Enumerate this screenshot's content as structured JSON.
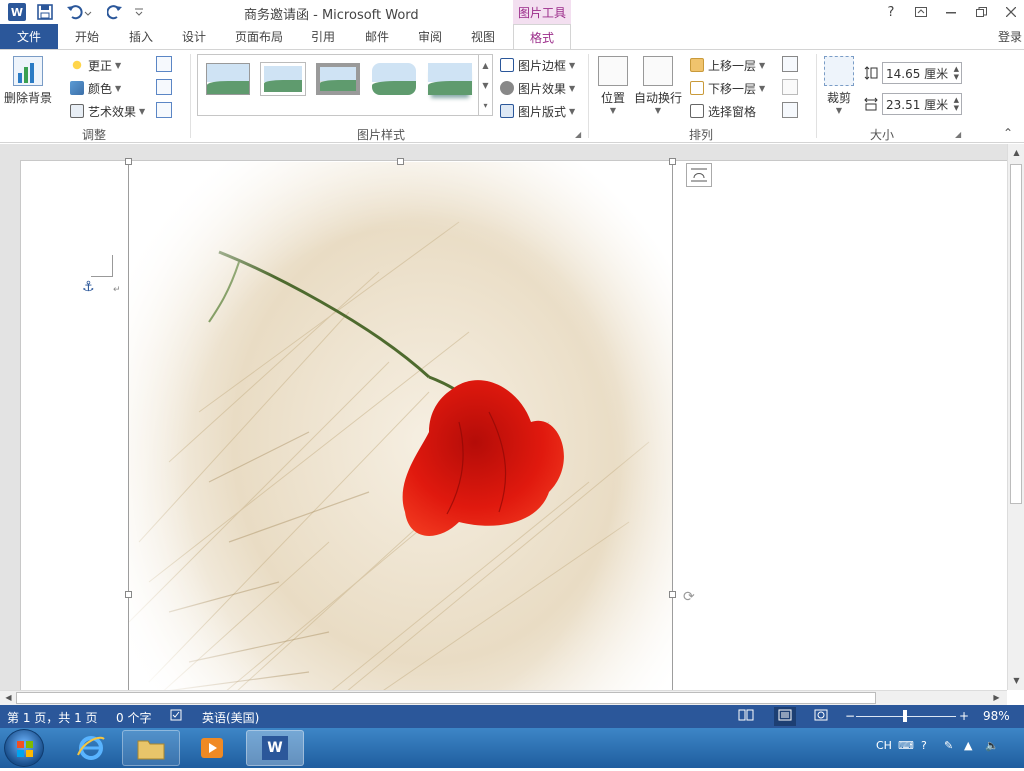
{
  "window": {
    "title": "商务邀请函 - Microsoft Word",
    "context_tab_group": "图片工具",
    "help": "?",
    "sign_in": "登录"
  },
  "tabs": [
    "文件",
    "开始",
    "插入",
    "设计",
    "页面布局",
    "引用",
    "邮件",
    "审阅",
    "视图",
    "格式"
  ],
  "ribbon": {
    "adjust": {
      "label": "调整",
      "remove_background": "删除背景",
      "corrections": "更正",
      "color": "颜色",
      "artistic_effects": "艺术效果"
    },
    "picture_styles": {
      "label": "图片样式",
      "border": "图片边框",
      "effects": "图片效果",
      "layout": "图片版式"
    },
    "arrange": {
      "label": "排列",
      "position": "位置",
      "wrap_text": "自动换行",
      "bring_forward": "上移一层",
      "send_backward": "下移一层",
      "selection_pane": "选择窗格"
    },
    "size": {
      "label": "大小",
      "crop": "裁剪",
      "height": "14.65 厘米",
      "width": "23.51 厘米"
    }
  },
  "status": {
    "page": "第 1 页，共 1 页",
    "words": "0 个字",
    "language": "英语(美国)",
    "zoom_minus": "−",
    "zoom_plus": "+",
    "zoom": "98%",
    "zoom_level": 0.49
  },
  "taskbar": {
    "word_label": "W",
    "ime": "CH"
  },
  "icons": {
    "app": "word-icon",
    "save": "save-icon",
    "undo": "undo-icon",
    "redo": "redo-icon",
    "anchor": "anchor-icon",
    "layout_options": "layout-options-icon"
  },
  "colors": {
    "accent": "#2b579a",
    "context": "#9b2c8a",
    "poppy": "#d81b10"
  }
}
